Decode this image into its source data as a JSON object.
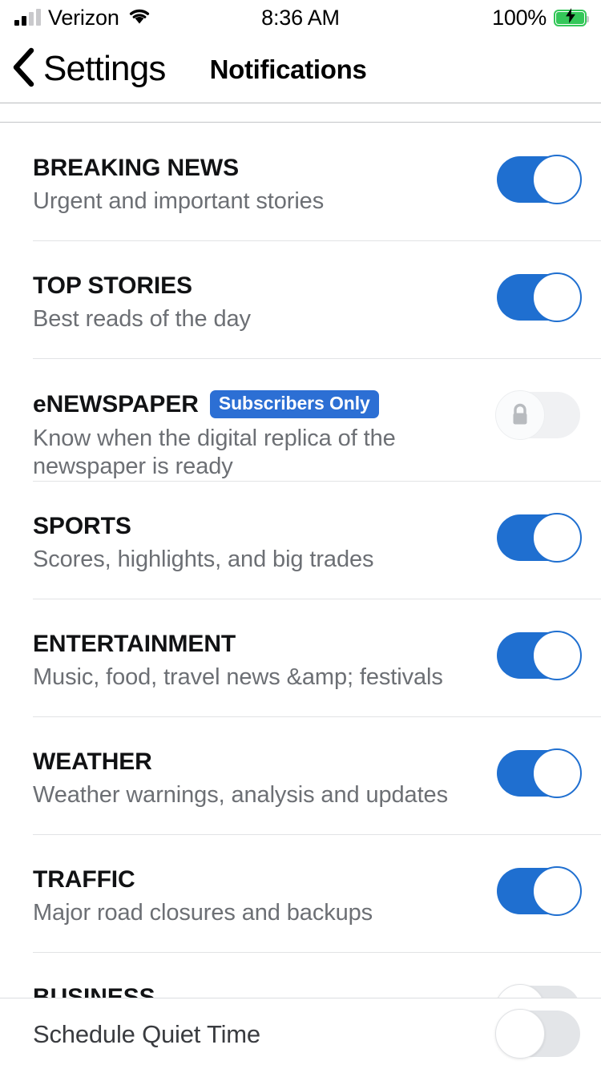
{
  "status_bar": {
    "carrier": "Verizon",
    "time": "8:36 AM",
    "battery_percent": "100%",
    "signal_icon": "signal-bars-icon",
    "wifi_icon": "wifi-icon",
    "battery_icon": "battery-charging-icon"
  },
  "header": {
    "back_label": "Settings",
    "back_icon": "chevron-left-icon",
    "title": "Notifications"
  },
  "colors": {
    "toggle_on": "#1f6fd0",
    "toggle_off": "#e3e5e8",
    "badge": "#2c6fd4",
    "battery_green": "#34c759",
    "subtitle": "#6c6f74"
  },
  "list": {
    "items": [
      {
        "title": "BREAKING NEWS",
        "subtitle": "Urgent and important stories",
        "badge": null,
        "toggle_state": "on"
      },
      {
        "title": "TOP STORIES",
        "subtitle": "Best reads of the day",
        "badge": null,
        "toggle_state": "on"
      },
      {
        "title": "eNEWSPAPER",
        "subtitle": "Know when the digital replica of the newspaper is ready",
        "badge": "Subscribers Only",
        "toggle_state": "locked"
      },
      {
        "title": "SPORTS",
        "subtitle": "Scores, highlights, and big trades",
        "badge": null,
        "toggle_state": "on"
      },
      {
        "title": "ENTERTAINMENT",
        "subtitle": "Music, food, travel news &amp; festivals",
        "badge": null,
        "toggle_state": "on"
      },
      {
        "title": "WEATHER",
        "subtitle": "Weather warnings, analysis and updates",
        "badge": null,
        "toggle_state": "on"
      },
      {
        "title": "TRAFFIC",
        "subtitle": "Major road closures and backups",
        "badge": null,
        "toggle_state": "on"
      },
      {
        "title": "BUSINESS",
        "subtitle": "",
        "badge": null,
        "toggle_state": "off"
      }
    ]
  },
  "bottom_bar": {
    "label": "Schedule Quiet Time",
    "toggle_state": "off"
  }
}
